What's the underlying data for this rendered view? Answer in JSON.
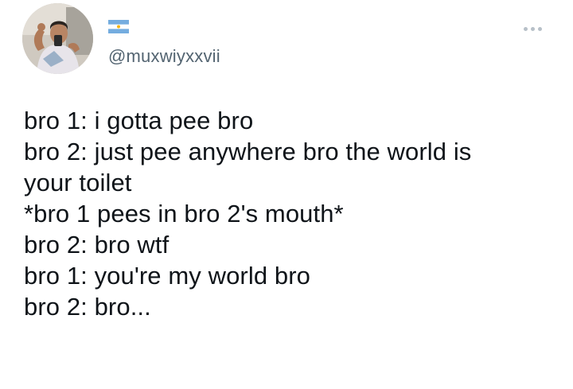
{
  "tweet": {
    "handle": "@muxwiyxxvii",
    "flag_icon": "argentina-flag-icon",
    "more_icon": "more-options-icon",
    "lines": [
      "bro 1: i gotta pee bro",
      "bro 2: just pee anywhere bro the world is",
      "your toilet",
      "*bro 1 pees in bro 2's mouth*",
      "bro 2: bro wtf",
      "bro 1: you're my world bro",
      "bro 2: bro..."
    ]
  },
  "colors": {
    "text": "#0f1419",
    "handle": "#536471",
    "flag_blue": "#74acdf",
    "flag_sun": "#f6b40e",
    "more_dots": "#b7c0c8"
  }
}
